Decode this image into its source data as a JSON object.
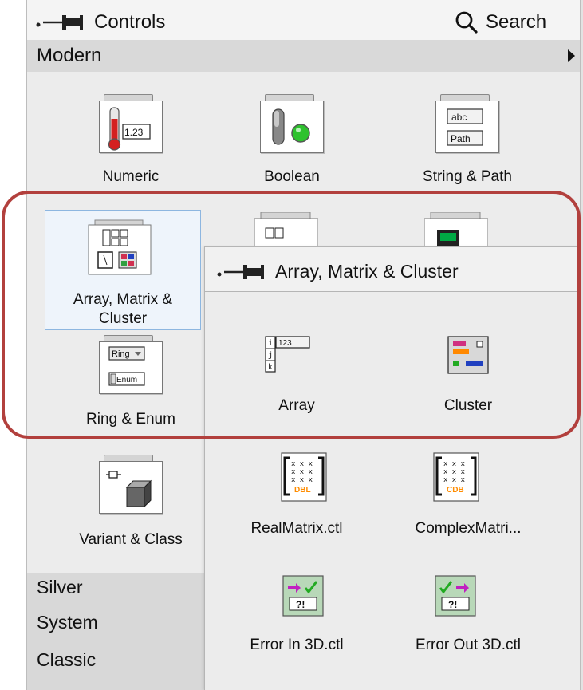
{
  "palette": {
    "title": "Controls",
    "search_label": "Search",
    "modern_label": "Modern",
    "items": [
      {
        "label": "Numeric",
        "icon": "numeric-icon"
      },
      {
        "label": "Boolean",
        "icon": "boolean-icon"
      },
      {
        "label": "String & Path",
        "icon": "string-path-icon"
      },
      {
        "label_line1": "Array, Matrix &",
        "label_line2": "Cluster",
        "icon": "array-matrix-cluster-icon",
        "selected": true
      },
      {
        "label": "Ring & Enum",
        "icon": "ring-enum-icon"
      },
      {
        "label": "Variant & Class",
        "icon": "variant-class-icon"
      }
    ],
    "categories": [
      "Silver",
      "System",
      "Classic"
    ]
  },
  "numeric_icon_text": "1.23",
  "string_icon_text": {
    "top": "abc",
    "bottom": "Path"
  },
  "ring_icon_text": {
    "top": "Ring",
    "bottom": "Enum"
  },
  "subpalette": {
    "title": "Array, Matrix & Cluster",
    "items": [
      {
        "label": "Array",
        "icon": "array-icon",
        "icon_text": "123"
      },
      {
        "label": "Cluster",
        "icon": "cluster-icon"
      },
      {
        "label": "RealMatrix.ctl",
        "icon": "real-matrix-icon",
        "icon_text": "DBL"
      },
      {
        "label": "ComplexMatri...",
        "icon": "complex-matrix-icon",
        "icon_text": "CDB"
      },
      {
        "label": "Error In 3D.ctl",
        "icon": "error-in-icon",
        "icon_text": "?!"
      },
      {
        "label": "Error Out 3D.ctl",
        "icon": "error-out-icon",
        "icon_text": "?!"
      }
    ]
  },
  "colors": {
    "highlight": "#b2403d",
    "selection_border": "#8db6e0",
    "boolean_led": "#2ec22e",
    "thermometer": "#d42020",
    "matrix_dbl": "#ff8c00"
  }
}
